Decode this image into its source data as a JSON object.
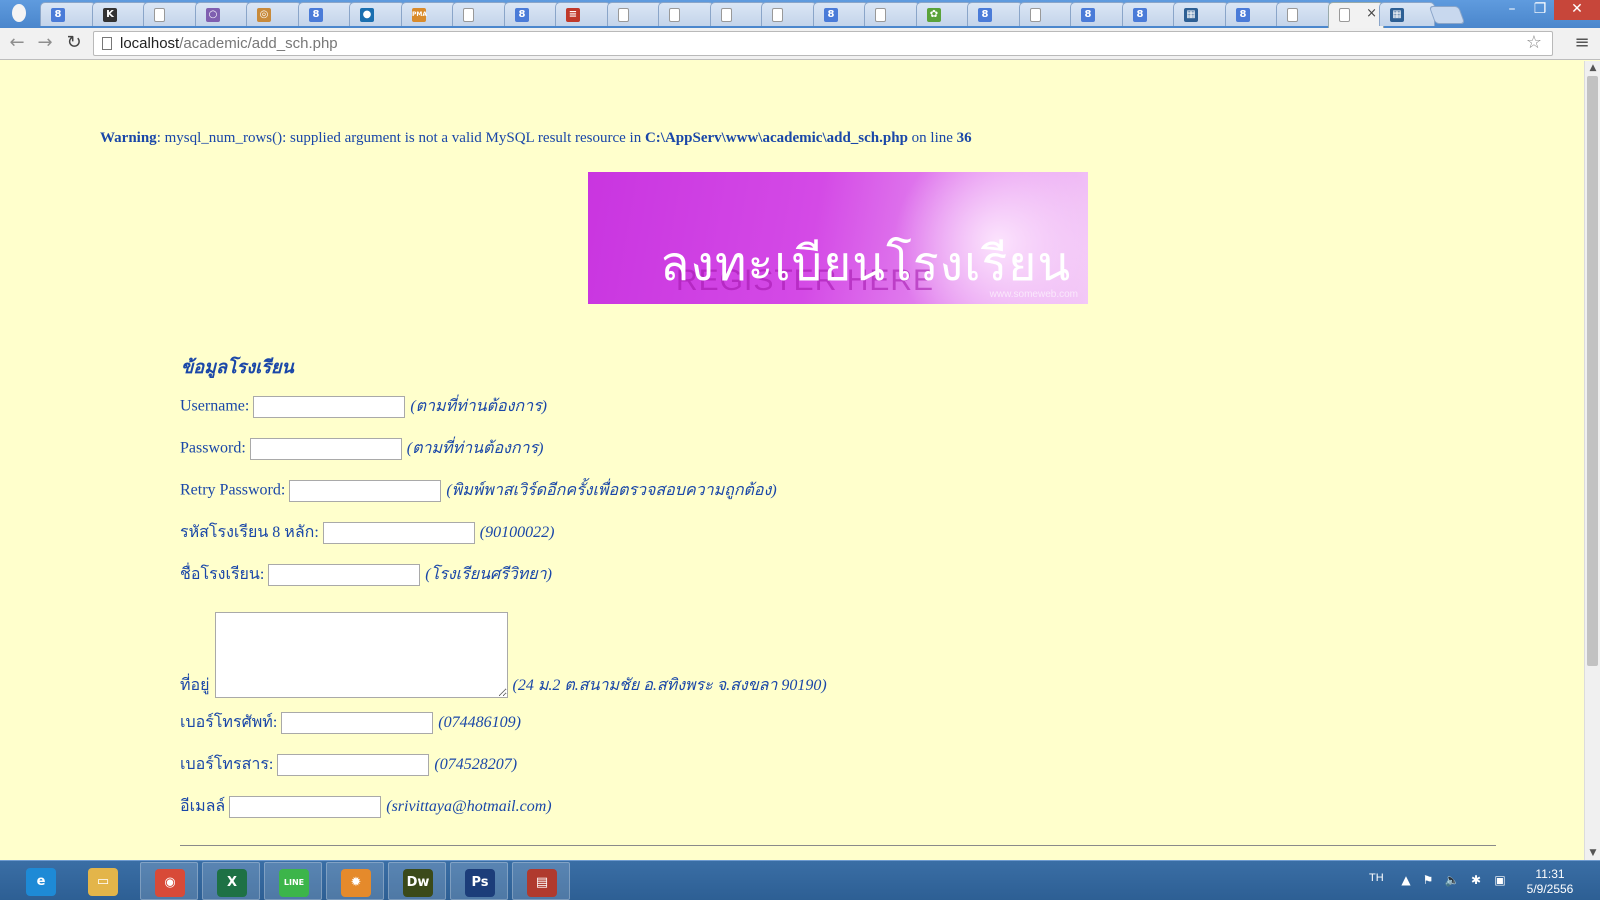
{
  "browser": {
    "tabs": [
      {
        "icon": "google-icon",
        "color": "#4a7bd8",
        "glyph": "8"
      },
      {
        "icon": "k-icon",
        "color": "#333333",
        "glyph": "K"
      },
      {
        "icon": "page-icon",
        "color": "#dddddd",
        "glyph": ""
      },
      {
        "icon": "circle-icon",
        "color": "#7f5fb0",
        "glyph": "○"
      },
      {
        "icon": "app-icon",
        "color": "#c88a3a",
        "glyph": "◎"
      },
      {
        "icon": "google-icon",
        "color": "#4a7bd8",
        "glyph": "8"
      },
      {
        "icon": "site-icon",
        "color": "#1a6fb0",
        "glyph": "●"
      },
      {
        "icon": "pma-icon",
        "color": "#d98b2b",
        "glyph": "PMA"
      },
      {
        "icon": "page-icon",
        "color": "#dddddd",
        "glyph": ""
      },
      {
        "icon": "google-icon",
        "color": "#4a7bd8",
        "glyph": "8"
      },
      {
        "icon": "flag-icon",
        "color": "#c0392b",
        "glyph": "≡"
      },
      {
        "icon": "page-icon",
        "color": "#dddddd",
        "glyph": ""
      },
      {
        "icon": "page-icon",
        "color": "#dddddd",
        "glyph": ""
      },
      {
        "icon": "page-icon",
        "color": "#dddddd",
        "glyph": ""
      },
      {
        "icon": "page-icon",
        "color": "#dddddd",
        "glyph": ""
      },
      {
        "icon": "google-icon",
        "color": "#4a7bd8",
        "glyph": "8"
      },
      {
        "icon": "page-icon",
        "color": "#dddddd",
        "glyph": ""
      },
      {
        "icon": "leaf-icon",
        "color": "#5aa33a",
        "glyph": "✿"
      },
      {
        "icon": "google-icon",
        "color": "#4a7bd8",
        "glyph": "8"
      },
      {
        "icon": "page-icon",
        "color": "#dddddd",
        "glyph": ""
      },
      {
        "icon": "google-icon",
        "color": "#4a7bd8",
        "glyph": "8"
      },
      {
        "icon": "google-icon",
        "color": "#4a7bd8",
        "glyph": "8"
      },
      {
        "icon": "calendar-icon",
        "color": "#2d5f94",
        "glyph": "▦"
      },
      {
        "icon": "google-icon",
        "color": "#4a7bd8",
        "glyph": "8"
      },
      {
        "icon": "page-icon",
        "color": "#dddddd",
        "glyph": ""
      },
      {
        "icon": "page-icon",
        "color": "#dddddd",
        "glyph": "",
        "active": true
      },
      {
        "icon": "calendar-icon",
        "color": "#2d5f94",
        "glyph": "▦"
      }
    ],
    "active_tab_close": "×",
    "window_controls": {
      "minimize": "–",
      "restore": "❐",
      "close": "✕"
    },
    "nav": {
      "back": "←",
      "forward": "→",
      "reload": "↻"
    },
    "url_host": "localhost",
    "url_path": "/academic/add_sch.php",
    "star": "☆",
    "menu": "≡"
  },
  "page": {
    "warning": {
      "label": "Warning",
      "text": ": mysql_num_rows(): supplied argument is not a valid MySQL result resource in ",
      "path": "C:\\AppServ\\www\\academic\\add_sch.php",
      "on_line": " on line ",
      "line": "36"
    },
    "banner": {
      "title": "ลงทะเบียนโรงเรียน",
      "subtitle": "REGISTER HERE",
      "watermark": "www.someweb.com"
    },
    "section_title": "ข้อมูลโรงเรียน",
    "fields": {
      "username": {
        "label": "Username:",
        "value": "",
        "hint": "(ตามที่ท่านต้องการ)"
      },
      "password": {
        "label": "Password:",
        "value": "",
        "hint": "(ตามที่ท่านต้องการ)"
      },
      "retry_password": {
        "label": "Retry Password:",
        "value": "",
        "hint": "(พิมพ์พาสเวิร์ดอีกครั้งเพื่อตรวจสอบความถูกต้อง)"
      },
      "school_code": {
        "label": "รหัสโรงเรียน 8 หลัก:",
        "value": "",
        "hint": "(90100022)"
      },
      "school_name": {
        "label": "ชื่อโรงเรียน:",
        "value": "",
        "hint": "(โรงเรียนศรีวิทยา)"
      },
      "address": {
        "label": "ที่อยู่",
        "value": "",
        "hint": "(24 ม.2 ต.สนามชัย อ.สทิงพระ จ.สงขลา 90190)"
      },
      "phone": {
        "label": "เบอร์โทรศัพท์:",
        "value": "",
        "hint": "(074486109)"
      },
      "fax": {
        "label": "เบอร์โทรสาร:",
        "value": "",
        "hint": "(074528207)"
      },
      "email": {
        "label": "อีเมลล์",
        "value": "",
        "hint": "(srivittaya@hotmail.com)"
      }
    }
  },
  "scrollbar": {
    "up": "▲",
    "down": "▼"
  },
  "taskbar": {
    "apps": [
      {
        "name": "internet-explorer",
        "glyph": "e",
        "color": "#1e8ad6",
        "open": false
      },
      {
        "name": "file-explorer",
        "glyph": "▭",
        "color": "#e3b54a",
        "open": false
      },
      {
        "name": "chrome",
        "glyph": "◉",
        "color": "#d84a38",
        "open": true
      },
      {
        "name": "excel",
        "glyph": "X",
        "color": "#1e7145",
        "open": true
      },
      {
        "name": "line",
        "glyph": "LINE",
        "color": "#3cb54a",
        "open": true
      },
      {
        "name": "settings",
        "glyph": "✹",
        "color": "#e58a2b",
        "open": true
      },
      {
        "name": "dreamweaver",
        "glyph": "Dw",
        "color": "#3b4a1a",
        "open": true
      },
      {
        "name": "photoshop",
        "glyph": "Ps",
        "color": "#1c3d7a",
        "open": true
      },
      {
        "name": "document-viewer",
        "glyph": "▤",
        "color": "#b03a2e",
        "open": true
      }
    ],
    "language": "TH",
    "tray": [
      "▲",
      "⚑",
      "🔈",
      "✱",
      "▣"
    ],
    "time": "11:31",
    "date": "5/9/2556"
  }
}
